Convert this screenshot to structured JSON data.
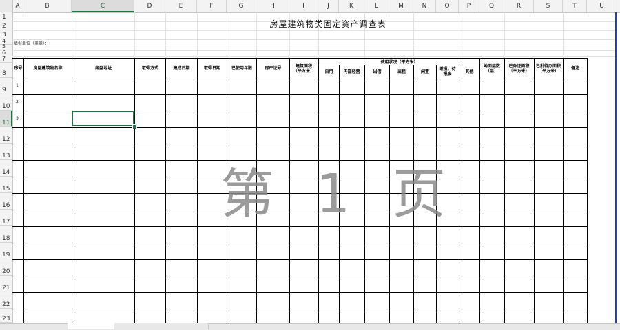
{
  "spreadsheet": {
    "columns": [
      "A",
      "B",
      "C",
      "D",
      "E",
      "F",
      "G",
      "H",
      "I",
      "J",
      "K",
      "L",
      "M",
      "N",
      "O",
      "P",
      "Q",
      "R",
      "S",
      "T",
      "U"
    ],
    "selected_column": "C",
    "rows": [
      "1",
      "2",
      "3",
      "4",
      "5",
      "6",
      "7",
      "8",
      "9",
      "10",
      "11",
      "12",
      "13",
      "14",
      "15",
      "16",
      "17",
      "18",
      "19",
      "20",
      "21",
      "22",
      "23"
    ],
    "selected_row": "11"
  },
  "sheet": {
    "title": "房屋建筑物类固定资产调查表",
    "unit_label": "填报单位（盖章）：",
    "headers": {
      "seq": "序号",
      "name": "房屋建筑物名称",
      "location": "房屋地址",
      "acquire_method": "取得方式",
      "build_date": "建成日期",
      "acquire_date": "取得日期",
      "years_used": "已使用年限",
      "cert_no": "房产证号",
      "area": "建筑面积（平方米）",
      "usage_group": "使用状况（平方米）",
      "self_use": "自用",
      "internal": "内部经营",
      "lend": "出借",
      "rent": "出租",
      "idle": "闲置",
      "damaged": "毁损、待报废",
      "other": "其他",
      "stories": "地面层数（层）",
      "land_area": "已办证面积（平方米）",
      "unreg_area": "已批待办面积（平方米）",
      "remark": "备注"
    },
    "row_numbers": [
      "1",
      "2",
      "3"
    ]
  },
  "watermark": "第 1 页",
  "colors": {
    "selection": "#217346",
    "scrollbar": "#1f3fb8",
    "watermark": "#8a8a8a"
  }
}
